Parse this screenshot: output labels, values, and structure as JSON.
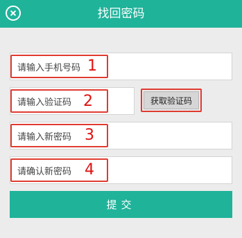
{
  "header": {
    "title": "找回密码",
    "close_icon": "close-icon"
  },
  "form": {
    "phone": {
      "placeholder": "请输入手机号码",
      "annotation": "1"
    },
    "code": {
      "placeholder": "请输入验证码",
      "annotation": "2"
    },
    "get_code_label": "获取验证码",
    "new_password": {
      "placeholder": "请输入新密码",
      "annotation": "3"
    },
    "confirm_password": {
      "placeholder": "请确认新密码",
      "annotation": "4"
    },
    "submit_label": "提交"
  },
  "colors": {
    "primary": "#1fb39a",
    "annotation": "#e01010",
    "background": "#ececec"
  }
}
